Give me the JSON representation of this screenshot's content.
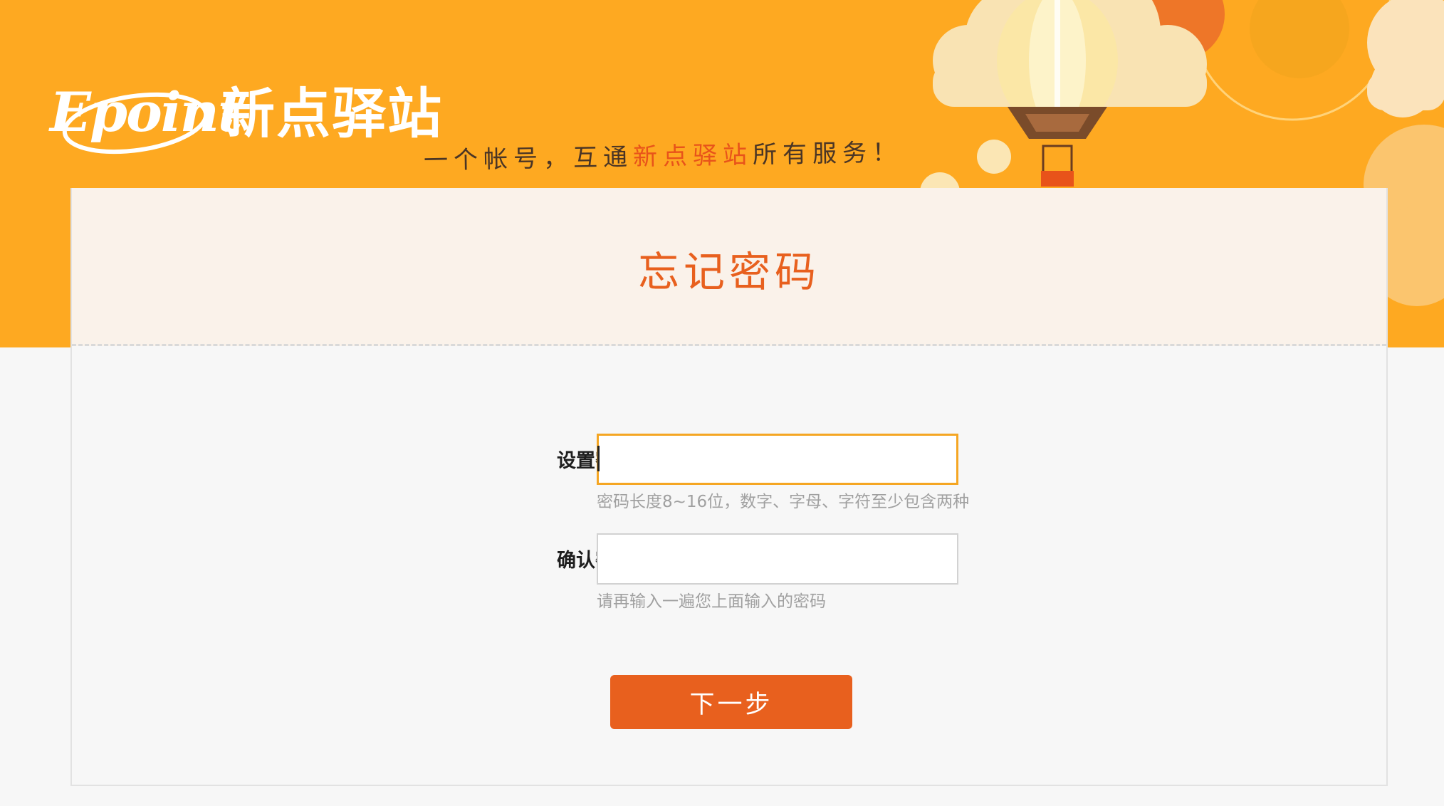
{
  "header": {
    "logo_en": "Epoint",
    "logo_cn": "新点驿站",
    "slogan_pre": "一个帐号，互通",
    "slogan_highlight": "新点驿站",
    "slogan_post": "所有服务！"
  },
  "card": {
    "title": "忘记密码"
  },
  "form": {
    "password": {
      "label": "设置密码：",
      "value": "",
      "hint": "密码长度8~16位，数字、字母、字符至少包含两种"
    },
    "confirm": {
      "label": "确认密码：",
      "value": "",
      "hint": "请再输入一遍您上面输入的密码"
    },
    "next_label": "下一步"
  },
  "colors": {
    "banner": "#fea921",
    "accent": "#e8601e",
    "focus_border": "#f5a623",
    "card_head_bg": "#faf2ea",
    "page_bg": "#f7f7f7"
  },
  "icons": [
    "hot-air-balloon-icon",
    "cloud-icon",
    "logo-orbit-icon"
  ]
}
